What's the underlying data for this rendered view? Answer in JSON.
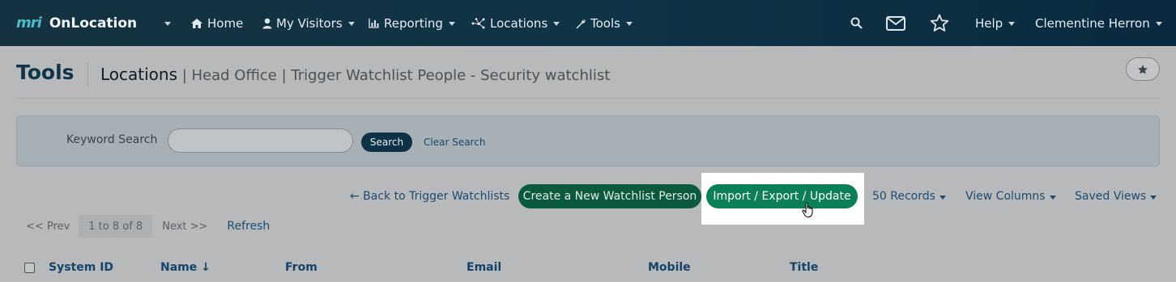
{
  "nav": {
    "brand_logo": "mri",
    "brand_name": "OnLocation",
    "items": [
      {
        "label": "Home",
        "icon": "home-icon"
      },
      {
        "label": "My Visitors",
        "icon": "user-icon"
      },
      {
        "label": "Reporting",
        "icon": "bar-chart-icon"
      },
      {
        "label": "Locations",
        "icon": "network-icon"
      },
      {
        "label": "Tools",
        "icon": "wrench-icon"
      }
    ],
    "help": "Help",
    "user": "Clementine Herron"
  },
  "page": {
    "title": "Tools",
    "breadcrumb_main": "Locations",
    "breadcrumb_sub": " | Head Office | Trigger Watchlist People - Security watchlist"
  },
  "search": {
    "label": "Keyword Search",
    "placeholder": "",
    "button": "Search",
    "clear": "Clear Search"
  },
  "actions": {
    "back": "← Back to Trigger Watchlists",
    "create": "Create a New Watchlist Person",
    "import": "Import / Export / Update",
    "records": "50 Records",
    "view_columns": "View Columns",
    "saved_views": "Saved Views"
  },
  "pager": {
    "prev": "<< Prev",
    "range": "1 to 8 of 8",
    "next": "Next >>",
    "refresh": "Refresh"
  },
  "table": {
    "columns": [
      "System ID",
      "Name ↓",
      "From",
      "Email",
      "Mobile",
      "Title"
    ]
  },
  "colors": {
    "nav_bg": "#0f3446",
    "accent_green": "#0b7f55",
    "link": "#1c4c74"
  }
}
